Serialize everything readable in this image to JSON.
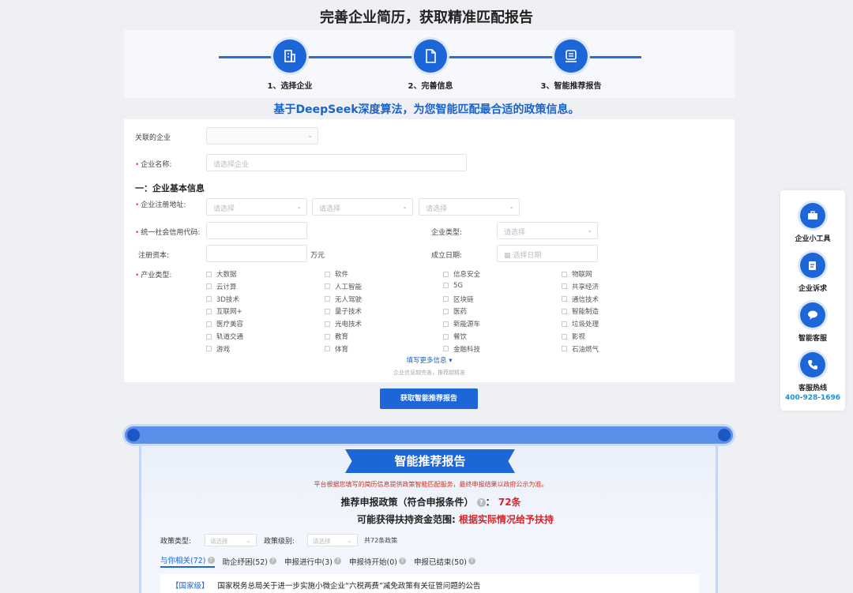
{
  "page_title": "完善企业简历，获取精准匹配报告",
  "steps": [
    {
      "label": "1、选择企业",
      "icon": "building-icon"
    },
    {
      "label": "2、完善信息",
      "icon": "document-icon"
    },
    {
      "label": "3、智能推荐报告",
      "icon": "report-icon"
    }
  ],
  "tagline": "基于DeepSeek深度算法，为您智能匹配最合适的政策信息。",
  "form": {
    "linked_company_label": "关联的企业",
    "linked_company_value": "",
    "company_name_label": "企业名称:",
    "company_name_placeholder": "请选择企业",
    "section_title": "一：企业基本信息",
    "reg_address_label": "企业注册地址:",
    "select_placeholder": "请选择",
    "credit_code_label": "统一社会信用代码:",
    "company_type_label": "企业类型:",
    "reg_capital_label": "注册资本:",
    "capital_unit": "万元",
    "established_label": "成立日期:",
    "date_placeholder": "选择日期",
    "industry_label": "产业类型:",
    "industries": [
      [
        "大数据",
        "软件",
        "信息安全",
        "物联网"
      ],
      [
        "云计算",
        "人工智能",
        "5G",
        "共享经济"
      ],
      [
        "3D技术",
        "无人驾驶",
        "区块链",
        "通信技术"
      ],
      [
        "互联网+",
        "量子技术",
        "医药",
        "智能制造"
      ],
      [
        "医疗美容",
        "光电技术",
        "新能源车",
        "垃圾处理"
      ],
      [
        "轨道交通",
        "教育",
        "餐饮",
        "影视"
      ],
      [
        "游戏",
        "体育",
        "金融科技",
        "石油燃气"
      ]
    ],
    "more_link": "填写更多信息",
    "more_hint": "企业信息越完善，推荐越精准"
  },
  "submit_label": "获取智能推荐报告",
  "sidebar": {
    "items": [
      {
        "label": "企业小工具",
        "icon": "toolbox-icon"
      },
      {
        "label": "企业诉求",
        "icon": "edit-icon"
      },
      {
        "label": "智能客服",
        "icon": "chat-icon"
      },
      {
        "label": "客服热线",
        "icon": "phone-icon"
      }
    ],
    "phone": "400-928-1696"
  },
  "report": {
    "banner": "智能推荐报告",
    "note": "平台根据您填写的简历信息提供政策智能匹配服务，最终申报结果以政府公示为准。",
    "count_label": "推荐申报政策（符合申报条件）",
    "count_value": "72条",
    "fund_label": "可能获得扶持资金范围:",
    "fund_value": "根据实际情况给予扶持",
    "policy_type_label": "政策类型:",
    "policy_level_label": "政策级别:",
    "select_placeholder": "请选择",
    "total_text": "共72条政策",
    "tabs": [
      {
        "label": "与你相关(72)"
      },
      {
        "label": "助企纾困(52)"
      },
      {
        "label": "申报进行中(3)"
      },
      {
        "label": "申报待开始(0)"
      },
      {
        "label": "申报已结束(50)"
      }
    ],
    "policy_level": "【国家级】",
    "policy_title": "国家税务总局关于进一步实施小微企业“六税两费”减免政策有关征管问题的公告"
  }
}
